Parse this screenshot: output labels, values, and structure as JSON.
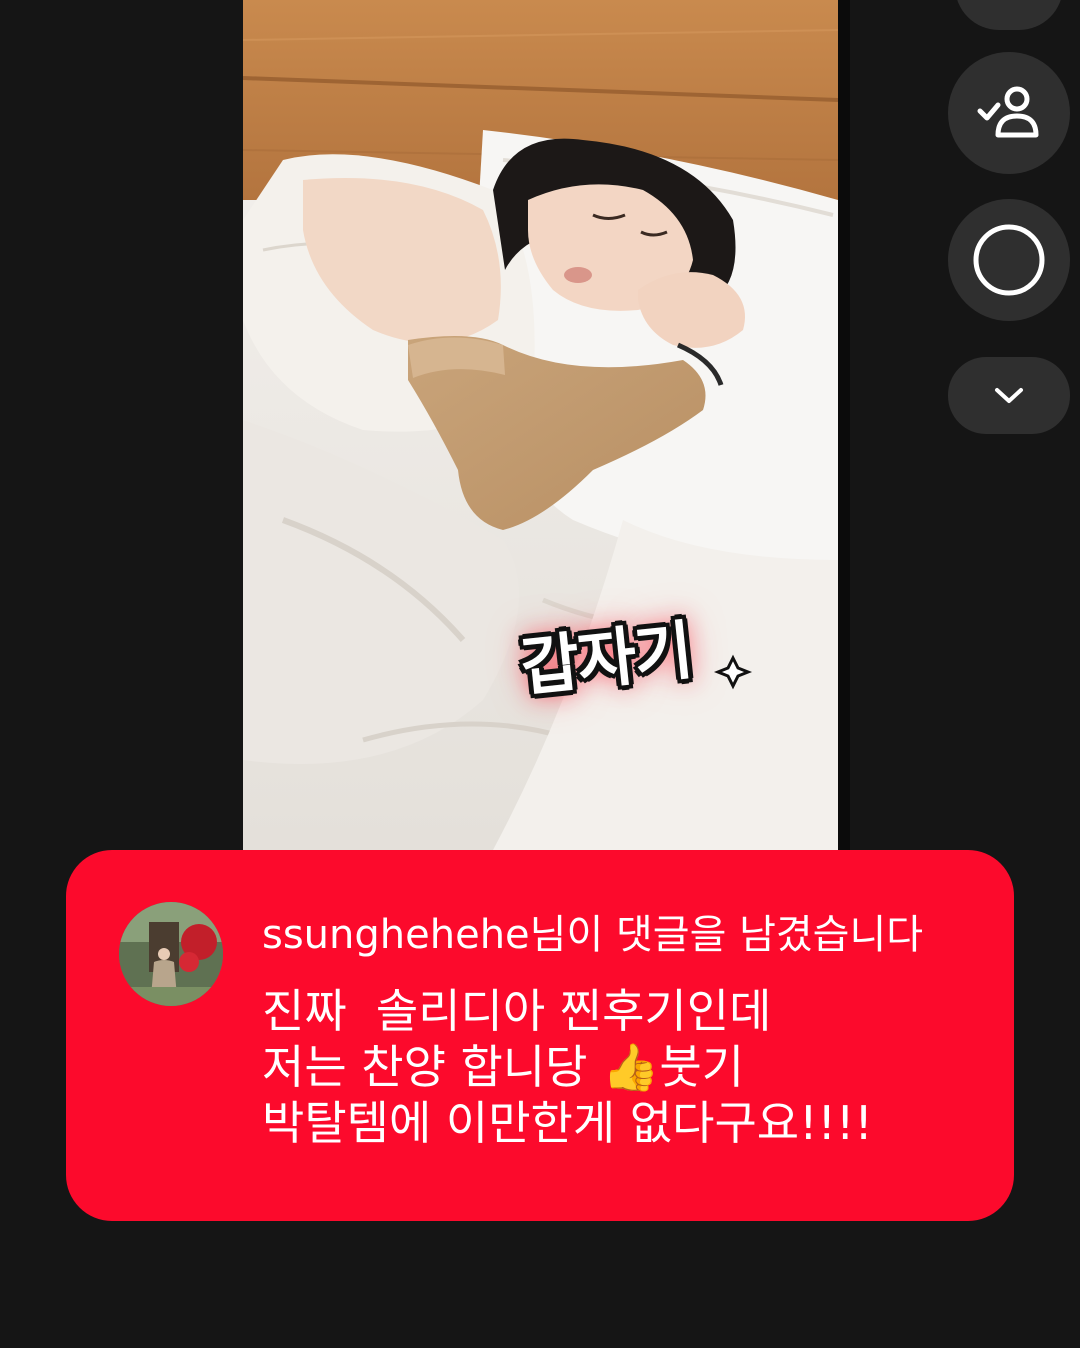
{
  "video": {
    "caption_sticker": "갑자기"
  },
  "side_controls": {
    "top_button_icon": "button-icon",
    "follow_icon": "person-check-icon",
    "record_icon": "circle-icon",
    "expand_icon": "chevron-down-icon"
  },
  "comment": {
    "username": "ssunghehehe",
    "notice_suffix": "님이 댓글을 남겼습니다",
    "lines": [
      "진짜  솔리디아 찐후기인데",
      "저는 찬양 합니당 👍붓기",
      "박탈템에 이만한게 없다구요!!!!"
    ]
  },
  "colors": {
    "background": "#151515",
    "card": "#fc0a2c",
    "button": "#2f2f2f",
    "text": "#ffffff"
  }
}
